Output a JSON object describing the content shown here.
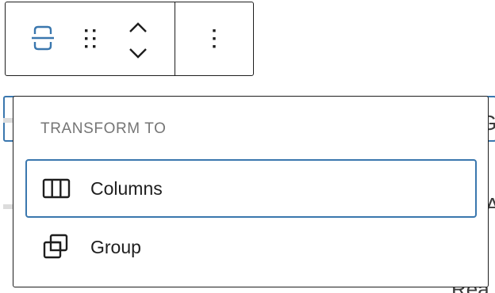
{
  "toolbar": {
    "buttons": [
      {
        "name": "transform-button",
        "icon": "block-transform-icon",
        "accent": "#3a77ae"
      },
      {
        "name": "drag-handle",
        "icon": "drag-dots-icon"
      },
      {
        "name": "move-up",
        "icon": "chevron-up-icon"
      },
      {
        "name": "move-down",
        "icon": "chevron-down-icon"
      },
      {
        "name": "options",
        "icon": "more-vertical-icon"
      }
    ]
  },
  "background": {
    "char_top": "G",
    "char_mid": "A",
    "char_bottom": "Rea"
  },
  "popover": {
    "heading": "TRANSFORM TO",
    "items": [
      {
        "label": "Columns",
        "icon": "columns-icon",
        "selected": true
      },
      {
        "label": "Group",
        "icon": "group-icon",
        "selected": false
      }
    ]
  },
  "colors": {
    "accent": "#3a77ae",
    "border": "#1e1e1e",
    "heading": "#757575"
  }
}
